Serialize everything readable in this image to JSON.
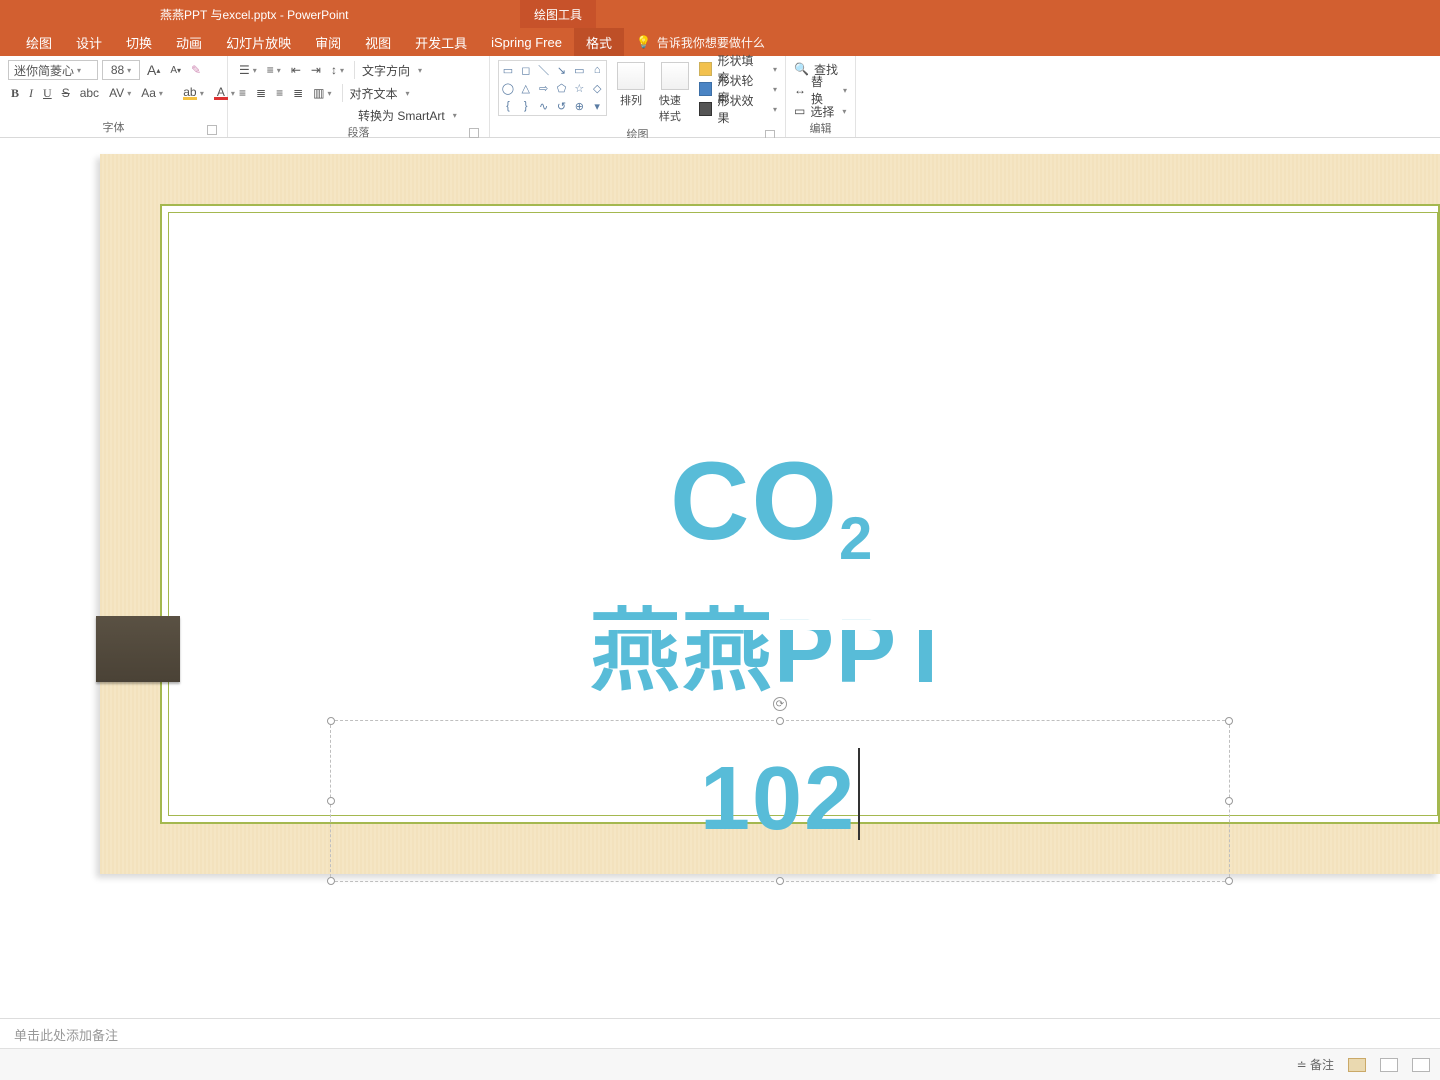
{
  "title": {
    "doc": "燕燕PPT 与excel.pptx  -  PowerPoint",
    "contextual": "绘图工具"
  },
  "tabs": {
    "items": [
      "绘图",
      "设计",
      "切换",
      "动画",
      "幻灯片放映",
      "审阅",
      "视图",
      "开发工具",
      "iSpring Free",
      "格式"
    ],
    "active": "格式",
    "tell_me": "告诉我你想要做什么"
  },
  "ribbon": {
    "font": {
      "name": "迷你简菱心",
      "size": "88",
      "grow": "A",
      "shrink": "A",
      "bold": "B",
      "italic": "I",
      "underline": "U",
      "strike": "S",
      "shadow": "abc",
      "spacing": "AV",
      "case": "Aa",
      "group_label": "字体"
    },
    "para": {
      "text_dir": "文字方向",
      "align_text": "对齐文本",
      "smartart": "转换为 SmartArt",
      "group_label": "段落"
    },
    "drawing": {
      "arrange": "排列",
      "quick": "快速样式",
      "fill": "形状填充",
      "outline": "形状轮廓",
      "effects": "形状效果",
      "group_label": "绘图"
    },
    "editing": {
      "find": "查找",
      "replace": "替换",
      "select": "选择",
      "group_label": "编辑"
    }
  },
  "slide": {
    "co2_main": "CO",
    "co2_sub": "2",
    "line2": "燕燕PPT",
    "line3": "102"
  },
  "notes": {
    "placeholder": "单击此处添加备注"
  },
  "status": {
    "notes_btn": "备注"
  }
}
